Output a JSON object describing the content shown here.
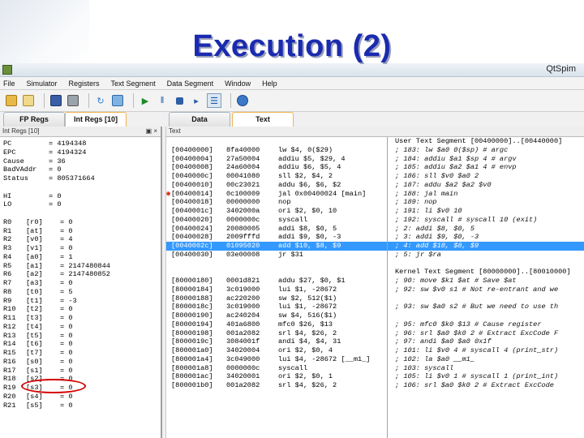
{
  "slide": {
    "title": "Execution (2)"
  },
  "window": {
    "app_name": "QtSpim"
  },
  "menu": [
    "File",
    "Simulator",
    "Registers",
    "Text Segment",
    "Data Segment",
    "Window",
    "Help"
  ],
  "tabs": {
    "fp_regs": "FP Regs",
    "int_regs": "Int Regs [10]",
    "data": "Data",
    "text": "Text"
  },
  "left_pane": {
    "header": "Int Regs [10]",
    "header_buttons": "▣ ×",
    "special_regs": [
      {
        "name": "PC",
        "value": "= 4194348"
      },
      {
        "name": "EPC",
        "value": "= 4194324"
      },
      {
        "name": "Cause",
        "value": "= 36"
      },
      {
        "name": "BadVAddr",
        "value": "= 0"
      },
      {
        "name": "Status",
        "value": "= 805371664"
      }
    ],
    "hilo_regs": [
      {
        "name": "HI",
        "value": "= 0"
      },
      {
        "name": "LO",
        "value": "= 0"
      }
    ],
    "gp_regs": [
      {
        "name": "R0",
        "alias": "[r0]",
        "value": "= 0"
      },
      {
        "name": "R1",
        "alias": "[at]",
        "value": "= 0"
      },
      {
        "name": "R2",
        "alias": "[v0]",
        "value": "= 4"
      },
      {
        "name": "R3",
        "alias": "[v1]",
        "value": "= 0"
      },
      {
        "name": "R4",
        "alias": "[a0]",
        "value": "= 1"
      },
      {
        "name": "R5",
        "alias": "[a1]",
        "value": "= 2147480844"
      },
      {
        "name": "R6",
        "alias": "[a2]",
        "value": "= 2147480852"
      },
      {
        "name": "R7",
        "alias": "[a3]",
        "value": "= 0"
      },
      {
        "name": "R8",
        "alias": "[t0]",
        "value": "= 5"
      },
      {
        "name": "R9",
        "alias": "[t1]",
        "value": "= -3"
      },
      {
        "name": "R10",
        "alias": "[t2]",
        "value": "= 0"
      },
      {
        "name": "R11",
        "alias": "[t3]",
        "value": "= 0"
      },
      {
        "name": "R12",
        "alias": "[t4]",
        "value": "= 0"
      },
      {
        "name": "R13",
        "alias": "[t5]",
        "value": "= 0"
      },
      {
        "name": "R14",
        "alias": "[t6]",
        "value": "= 0"
      },
      {
        "name": "R15",
        "alias": "[t7]",
        "value": "= 0"
      },
      {
        "name": "R16",
        "alias": "[s0]",
        "value": "= 0"
      },
      {
        "name": "R17",
        "alias": "[s1]",
        "value": "= 0"
      },
      {
        "name": "R18",
        "alias": "[s2]",
        "value": "= 0"
      },
      {
        "name": "R19",
        "alias": "[s3]",
        "value": "= 0"
      },
      {
        "name": "R20",
        "alias": "[s4]",
        "value": "= 0"
      },
      {
        "name": "R21",
        "alias": "[s5]",
        "value": "= 0"
      }
    ]
  },
  "right_pane": {
    "header": "Text",
    "user_segment_title": "User Text Segment [00400000]..[00440000]",
    "user_rows": [
      {
        "addr": "[00400000]",
        "word": "8fa40000",
        "src": "lw $4, 0($29)",
        "comment": "; 183: lw $a0 0($sp) # argc"
      },
      {
        "addr": "[00400004]",
        "word": "27a50004",
        "src": "addiu $5, $29, 4",
        "comment": "; 184: addiu $a1 $sp 4 # argv"
      },
      {
        "addr": "[00400008]",
        "word": "24a60004",
        "src": "addiu $6, $5, 4",
        "comment": "; 185: addiu $a2 $a1 4 # envp"
      },
      {
        "addr": "[0040000c]",
        "word": "00041080",
        "src": "sll $2, $4, 2",
        "comment": "; 186: sll $v0 $a0 2"
      },
      {
        "addr": "[00400010]",
        "word": "00c23021",
        "src": "addu $6, $6, $2",
        "comment": "; 187: addu $a2 $a2 $v0"
      },
      {
        "addr": "[00400014]",
        "word": "0c100009",
        "src": "jal 0x00400024 [main]",
        "comment": "; 188: jal main",
        "breakpoint": "◉"
      },
      {
        "addr": "[00400018]",
        "word": "00000000",
        "src": "nop",
        "comment": "; 189: nop"
      },
      {
        "addr": "[0040001c]",
        "word": "3402000a",
        "src": "ori $2, $0, 10",
        "comment": "; 191: li $v0 10"
      },
      {
        "addr": "[00400020]",
        "word": "0000000c",
        "src": "syscall",
        "comment": "; 192: syscall # syscall 10 (exit)"
      },
      {
        "addr": "[00400024]",
        "word": "20080005",
        "src": "addi $8, $0, 5",
        "comment": "; 2: addi $8, $0, 5"
      },
      {
        "addr": "[00400028]",
        "word": "2009fffd",
        "src": "addi $9, $0, -3",
        "comment": "; 3: addi $9, $0, -3"
      },
      {
        "addr": "[0040002c]",
        "word": "01095020",
        "src": "add $10, $8, $9",
        "comment": "; 4: add $10, $8, $9",
        "highlight": true
      },
      {
        "addr": "[00400030]",
        "word": "03e00008",
        "src": "jr $31",
        "comment": "; 5: jr $ra"
      }
    ],
    "kernel_segment_title": "Kernel Text Segment [80000000]..[80010000]",
    "kernel_rows": [
      {
        "addr": "[80000180]",
        "word": "0001d821",
        "src": "addu $27, $0, $1",
        "comment": "; 90: move $k1 $at # Save $at"
      },
      {
        "addr": "[80000184]",
        "word": "3c019000",
        "src": "lui $1, -28672",
        "comment": "; 92: sw $v0 s1 # Not re-entrant and we"
      },
      {
        "addr": "[80000188]",
        "word": "ac220200",
        "src": "sw $2, 512($1)",
        "comment": ""
      },
      {
        "addr": "[8000018c]",
        "word": "3c019000",
        "src": "lui $1, -28672",
        "comment": "; 93: sw $a0 s2 # But we need to use th"
      },
      {
        "addr": "[80000190]",
        "word": "ac240204",
        "src": "sw $4, 516($1)",
        "comment": ""
      },
      {
        "addr": "[80000194]",
        "word": "401a6800",
        "src": "mfc0 $26, $13",
        "comment": "; 95: mfc0 $k0 $13 # Cause register"
      },
      {
        "addr": "[80000198]",
        "word": "001a2082",
        "src": "srl $4, $26, 2",
        "comment": "; 96: srl $a0 $k0 2 # Extract ExcCode F"
      },
      {
        "addr": "[8000019c]",
        "word": "3084001f",
        "src": "andi $4, $4, 31",
        "comment": "; 97: andi $a0 $a0 0x1f"
      },
      {
        "addr": "[800001a0]",
        "word": "34020004",
        "src": "ori $2, $0, 4",
        "comment": "; 101: li $v0 4 # syscall 4 (print_str)"
      },
      {
        "addr": "[800001a4]",
        "word": "3c049000",
        "src": "lui $4, -28672 [__m1_]",
        "comment": "; 102: la $a0 __m1_"
      },
      {
        "addr": "[800001a8]",
        "word": "0000000c",
        "src": "syscall",
        "comment": "; 103: syscall"
      },
      {
        "addr": "[800001ac]",
        "word": "34020001",
        "src": "ori $2, $0, 1",
        "comment": "; 105: li $v0 1 # syscall 1 (print_int)"
      },
      {
        "addr": "[800001b0]",
        "word": "001a2082",
        "src": "srl $4, $26, 2",
        "comment": "; 106: srl $a0 $k0 2 # Extract ExcCode"
      }
    ]
  },
  "colors": {
    "title": "#1a2bb0",
    "highlight_row": "#3399ff",
    "annotation": "#d40000"
  },
  "icons": [
    "folder-open-icon",
    "reload-icon",
    "save-icon",
    "print-icon",
    "clear-registers-icon",
    "reinitialize-icon",
    "run-icon",
    "pause-icon",
    "stop-icon",
    "step-icon",
    "step-box-icon",
    "help-icon"
  ]
}
